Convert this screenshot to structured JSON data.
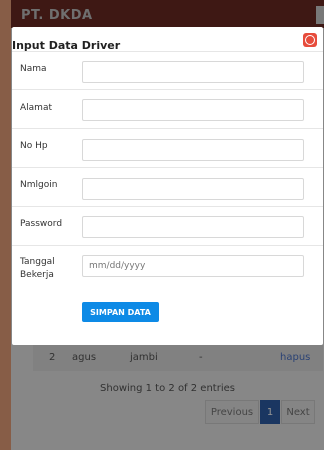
{
  "background": {
    "header_title": "PT. DKDA",
    "table_row": {
      "no": "2",
      "nama": "agus",
      "alamat": "jambi",
      "no_hp": "-",
      "action": "hapus"
    },
    "info_text": "Showing 1 to 2 of 2 entries",
    "pagination": {
      "previous": "Previous",
      "current": "1",
      "next": "Next"
    }
  },
  "modal": {
    "title": "Input Data Driver",
    "close_icon": "close-icon",
    "fields": [
      {
        "label": "Nama",
        "value": "",
        "placeholder": ""
      },
      {
        "label": "Alamat",
        "value": "",
        "placeholder": ""
      },
      {
        "label": "No Hp",
        "value": "",
        "placeholder": ""
      },
      {
        "label": "Nmlgoin",
        "value": "",
        "placeholder": ""
      },
      {
        "label": "Password",
        "value": "",
        "placeholder": ""
      },
      {
        "label": "Tanggal Bekerja",
        "value": "",
        "placeholder": "mm/dd/yyyy"
      }
    ],
    "submit_label": "SIMPAN DATA"
  },
  "colors": {
    "header": "#6b2a24",
    "accent": "#0d8ae6",
    "close": "#e74c3c",
    "active_page": "#2d5ea8"
  }
}
